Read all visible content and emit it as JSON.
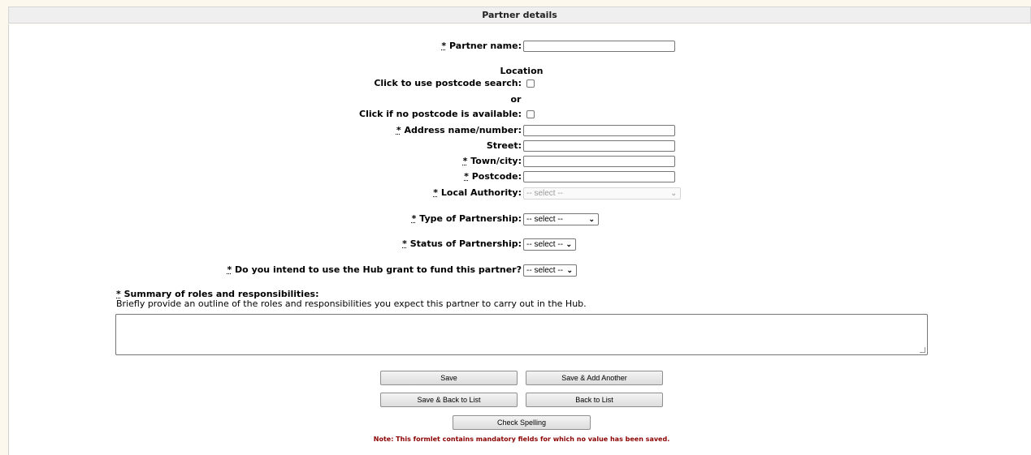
{
  "header": {
    "title": "Partner details"
  },
  "required_marker": "*",
  "fields": {
    "partner_name": {
      "label": "Partner name:",
      "value": ""
    },
    "location_heading": "Location",
    "postcode_search": {
      "label": "Click to use postcode search:"
    },
    "or_text": "or",
    "no_postcode": {
      "label": "Click if no postcode is available:"
    },
    "address": {
      "label": "Address name/number:",
      "value": ""
    },
    "street": {
      "label": "Street:",
      "value": ""
    },
    "town": {
      "label": "Town/city:",
      "value": ""
    },
    "postcode": {
      "label": "Postcode:",
      "value": ""
    },
    "local_authority": {
      "label": "Local Authority:",
      "selected": "-- select --"
    },
    "type_of_partnership": {
      "label": "Type of Partnership:",
      "selected": "-- select --"
    },
    "status_of_partnership": {
      "label": "Status of Partnership:",
      "selected": "-- select --"
    },
    "hub_grant": {
      "label": "Do you intend to use the Hub grant to fund this partner?",
      "selected": "-- select --"
    },
    "summary": {
      "label": "Summary of roles and responsibilities:",
      "help": "Briefly provide an outline of the roles and responsibilities you expect this partner to carry out in the Hub.",
      "value": ""
    }
  },
  "buttons": {
    "save": "Save",
    "save_add_another": "Save & Add Another",
    "save_back": "Save & Back to List",
    "back": "Back to List",
    "check_spelling": "Check Spelling"
  },
  "note": "Note: This formlet contains mandatory fields for which no value has been saved.",
  "colors": {
    "background": "#fcf8ee",
    "note": "#8b0000"
  },
  "icons": {
    "select_chevron": "chevron-down-icon"
  }
}
